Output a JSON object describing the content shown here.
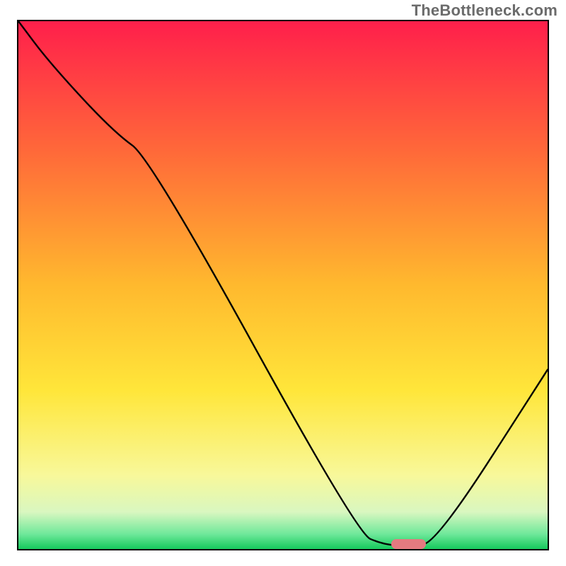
{
  "watermark": "TheBottleneck.com",
  "chart_data": {
    "type": "line",
    "title": "",
    "xlabel": "",
    "ylabel": "",
    "xlim": [
      0,
      100
    ],
    "ylim": [
      0,
      100
    ],
    "background_gradient": {
      "stops": [
        {
          "offset": 0,
          "color": "#ff1f4b"
        },
        {
          "offset": 0.25,
          "color": "#ff6a39"
        },
        {
          "offset": 0.5,
          "color": "#ffb92e"
        },
        {
          "offset": 0.7,
          "color": "#ffe63a"
        },
        {
          "offset": 0.86,
          "color": "#f8f89a"
        },
        {
          "offset": 0.93,
          "color": "#d9f7c0"
        },
        {
          "offset": 0.972,
          "color": "#6ee89a"
        },
        {
          "offset": 1.0,
          "color": "#15c95c"
        }
      ]
    },
    "series": [
      {
        "name": "bottleneck-curve",
        "x": [
          0,
          6,
          18,
          25,
          64,
          69,
          74,
          79,
          100
        ],
        "y": [
          100,
          92,
          79,
          74,
          3,
          0.8,
          0.6,
          1.2,
          34
        ]
      }
    ],
    "marker": {
      "name": "optimal-range",
      "x_start": 70.5,
      "x_end": 77,
      "y": 0.9,
      "color": "#e47a80"
    }
  }
}
